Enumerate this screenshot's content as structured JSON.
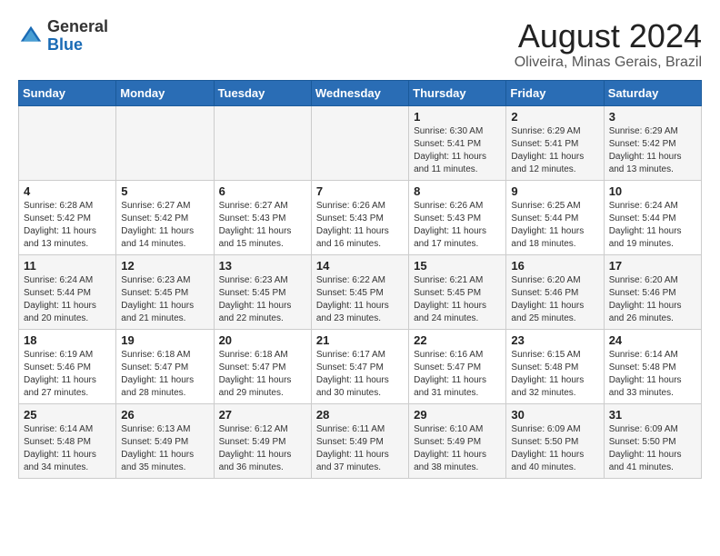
{
  "header": {
    "logo_general": "General",
    "logo_blue": "Blue",
    "month_year": "August 2024",
    "location": "Oliveira, Minas Gerais, Brazil"
  },
  "weekdays": [
    "Sunday",
    "Monday",
    "Tuesday",
    "Wednesday",
    "Thursday",
    "Friday",
    "Saturday"
  ],
  "weeks": [
    [
      {
        "day": "",
        "info": ""
      },
      {
        "day": "",
        "info": ""
      },
      {
        "day": "",
        "info": ""
      },
      {
        "day": "",
        "info": ""
      },
      {
        "day": "1",
        "info": "Sunrise: 6:30 AM\nSunset: 5:41 PM\nDaylight: 11 hours and 11 minutes."
      },
      {
        "day": "2",
        "info": "Sunrise: 6:29 AM\nSunset: 5:41 PM\nDaylight: 11 hours and 12 minutes."
      },
      {
        "day": "3",
        "info": "Sunrise: 6:29 AM\nSunset: 5:42 PM\nDaylight: 11 hours and 13 minutes."
      }
    ],
    [
      {
        "day": "4",
        "info": "Sunrise: 6:28 AM\nSunset: 5:42 PM\nDaylight: 11 hours and 13 minutes."
      },
      {
        "day": "5",
        "info": "Sunrise: 6:27 AM\nSunset: 5:42 PM\nDaylight: 11 hours and 14 minutes."
      },
      {
        "day": "6",
        "info": "Sunrise: 6:27 AM\nSunset: 5:43 PM\nDaylight: 11 hours and 15 minutes."
      },
      {
        "day": "7",
        "info": "Sunrise: 6:26 AM\nSunset: 5:43 PM\nDaylight: 11 hours and 16 minutes."
      },
      {
        "day": "8",
        "info": "Sunrise: 6:26 AM\nSunset: 5:43 PM\nDaylight: 11 hours and 17 minutes."
      },
      {
        "day": "9",
        "info": "Sunrise: 6:25 AM\nSunset: 5:44 PM\nDaylight: 11 hours and 18 minutes."
      },
      {
        "day": "10",
        "info": "Sunrise: 6:24 AM\nSunset: 5:44 PM\nDaylight: 11 hours and 19 minutes."
      }
    ],
    [
      {
        "day": "11",
        "info": "Sunrise: 6:24 AM\nSunset: 5:44 PM\nDaylight: 11 hours and 20 minutes."
      },
      {
        "day": "12",
        "info": "Sunrise: 6:23 AM\nSunset: 5:45 PM\nDaylight: 11 hours and 21 minutes."
      },
      {
        "day": "13",
        "info": "Sunrise: 6:23 AM\nSunset: 5:45 PM\nDaylight: 11 hours and 22 minutes."
      },
      {
        "day": "14",
        "info": "Sunrise: 6:22 AM\nSunset: 5:45 PM\nDaylight: 11 hours and 23 minutes."
      },
      {
        "day": "15",
        "info": "Sunrise: 6:21 AM\nSunset: 5:45 PM\nDaylight: 11 hours and 24 minutes."
      },
      {
        "day": "16",
        "info": "Sunrise: 6:20 AM\nSunset: 5:46 PM\nDaylight: 11 hours and 25 minutes."
      },
      {
        "day": "17",
        "info": "Sunrise: 6:20 AM\nSunset: 5:46 PM\nDaylight: 11 hours and 26 minutes."
      }
    ],
    [
      {
        "day": "18",
        "info": "Sunrise: 6:19 AM\nSunset: 5:46 PM\nDaylight: 11 hours and 27 minutes."
      },
      {
        "day": "19",
        "info": "Sunrise: 6:18 AM\nSunset: 5:47 PM\nDaylight: 11 hours and 28 minutes."
      },
      {
        "day": "20",
        "info": "Sunrise: 6:18 AM\nSunset: 5:47 PM\nDaylight: 11 hours and 29 minutes."
      },
      {
        "day": "21",
        "info": "Sunrise: 6:17 AM\nSunset: 5:47 PM\nDaylight: 11 hours and 30 minutes."
      },
      {
        "day": "22",
        "info": "Sunrise: 6:16 AM\nSunset: 5:47 PM\nDaylight: 11 hours and 31 minutes."
      },
      {
        "day": "23",
        "info": "Sunrise: 6:15 AM\nSunset: 5:48 PM\nDaylight: 11 hours and 32 minutes."
      },
      {
        "day": "24",
        "info": "Sunrise: 6:14 AM\nSunset: 5:48 PM\nDaylight: 11 hours and 33 minutes."
      }
    ],
    [
      {
        "day": "25",
        "info": "Sunrise: 6:14 AM\nSunset: 5:48 PM\nDaylight: 11 hours and 34 minutes."
      },
      {
        "day": "26",
        "info": "Sunrise: 6:13 AM\nSunset: 5:49 PM\nDaylight: 11 hours and 35 minutes."
      },
      {
        "day": "27",
        "info": "Sunrise: 6:12 AM\nSunset: 5:49 PM\nDaylight: 11 hours and 36 minutes."
      },
      {
        "day": "28",
        "info": "Sunrise: 6:11 AM\nSunset: 5:49 PM\nDaylight: 11 hours and 37 minutes."
      },
      {
        "day": "29",
        "info": "Sunrise: 6:10 AM\nSunset: 5:49 PM\nDaylight: 11 hours and 38 minutes."
      },
      {
        "day": "30",
        "info": "Sunrise: 6:09 AM\nSunset: 5:50 PM\nDaylight: 11 hours and 40 minutes."
      },
      {
        "day": "31",
        "info": "Sunrise: 6:09 AM\nSunset: 5:50 PM\nDaylight: 11 hours and 41 minutes."
      }
    ]
  ]
}
